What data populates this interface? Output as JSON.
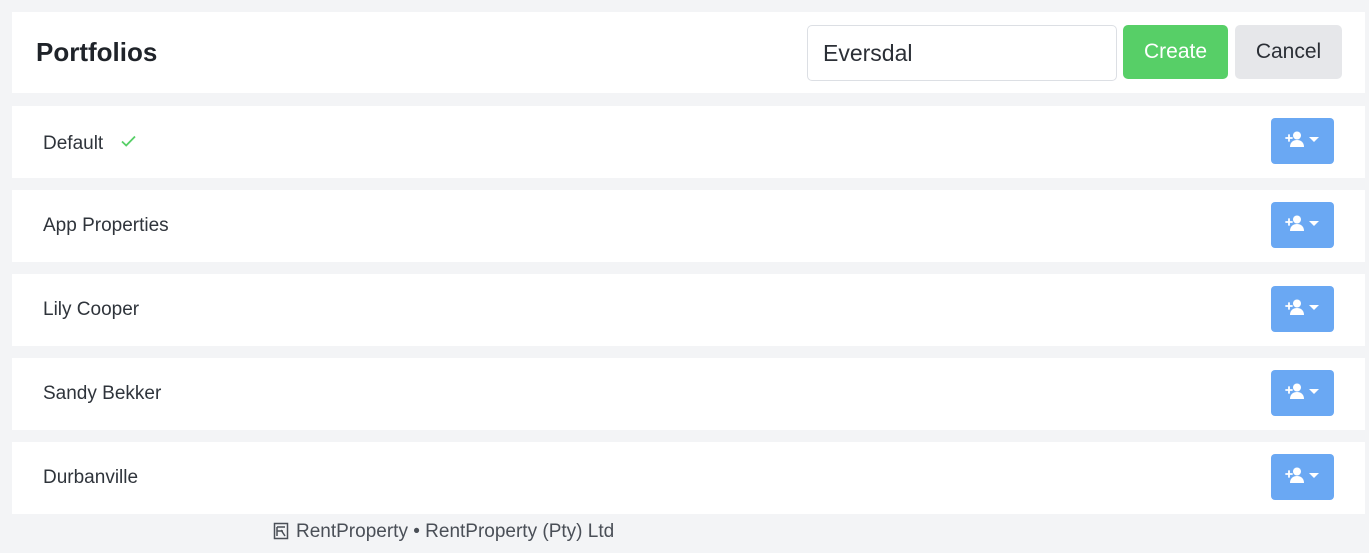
{
  "header": {
    "title": "Portfolios",
    "input_value": "Eversdal",
    "create_label": "Create",
    "cancel_label": "Cancel"
  },
  "portfolios": [
    {
      "label": "Default",
      "is_default": true
    },
    {
      "label": "App Properties",
      "is_default": false
    },
    {
      "label": "Lily Cooper",
      "is_default": false
    },
    {
      "label": "Sandy Bekker",
      "is_default": false
    },
    {
      "label": "Durbanville",
      "is_default": false
    }
  ],
  "icons": {
    "default_marker": "check-icon",
    "row_action": "add-user-dropdown-icon",
    "footer_logo": "rentproperty-logo-icon"
  },
  "footer": {
    "text": "RentProperty • RentProperty (Pty) Ltd"
  },
  "colors": {
    "create": "#57cf67",
    "cancel": "#e6e7ea",
    "row_action": "#6aa8f3",
    "check": "#57cf67",
    "background": "#f3f4f6"
  }
}
